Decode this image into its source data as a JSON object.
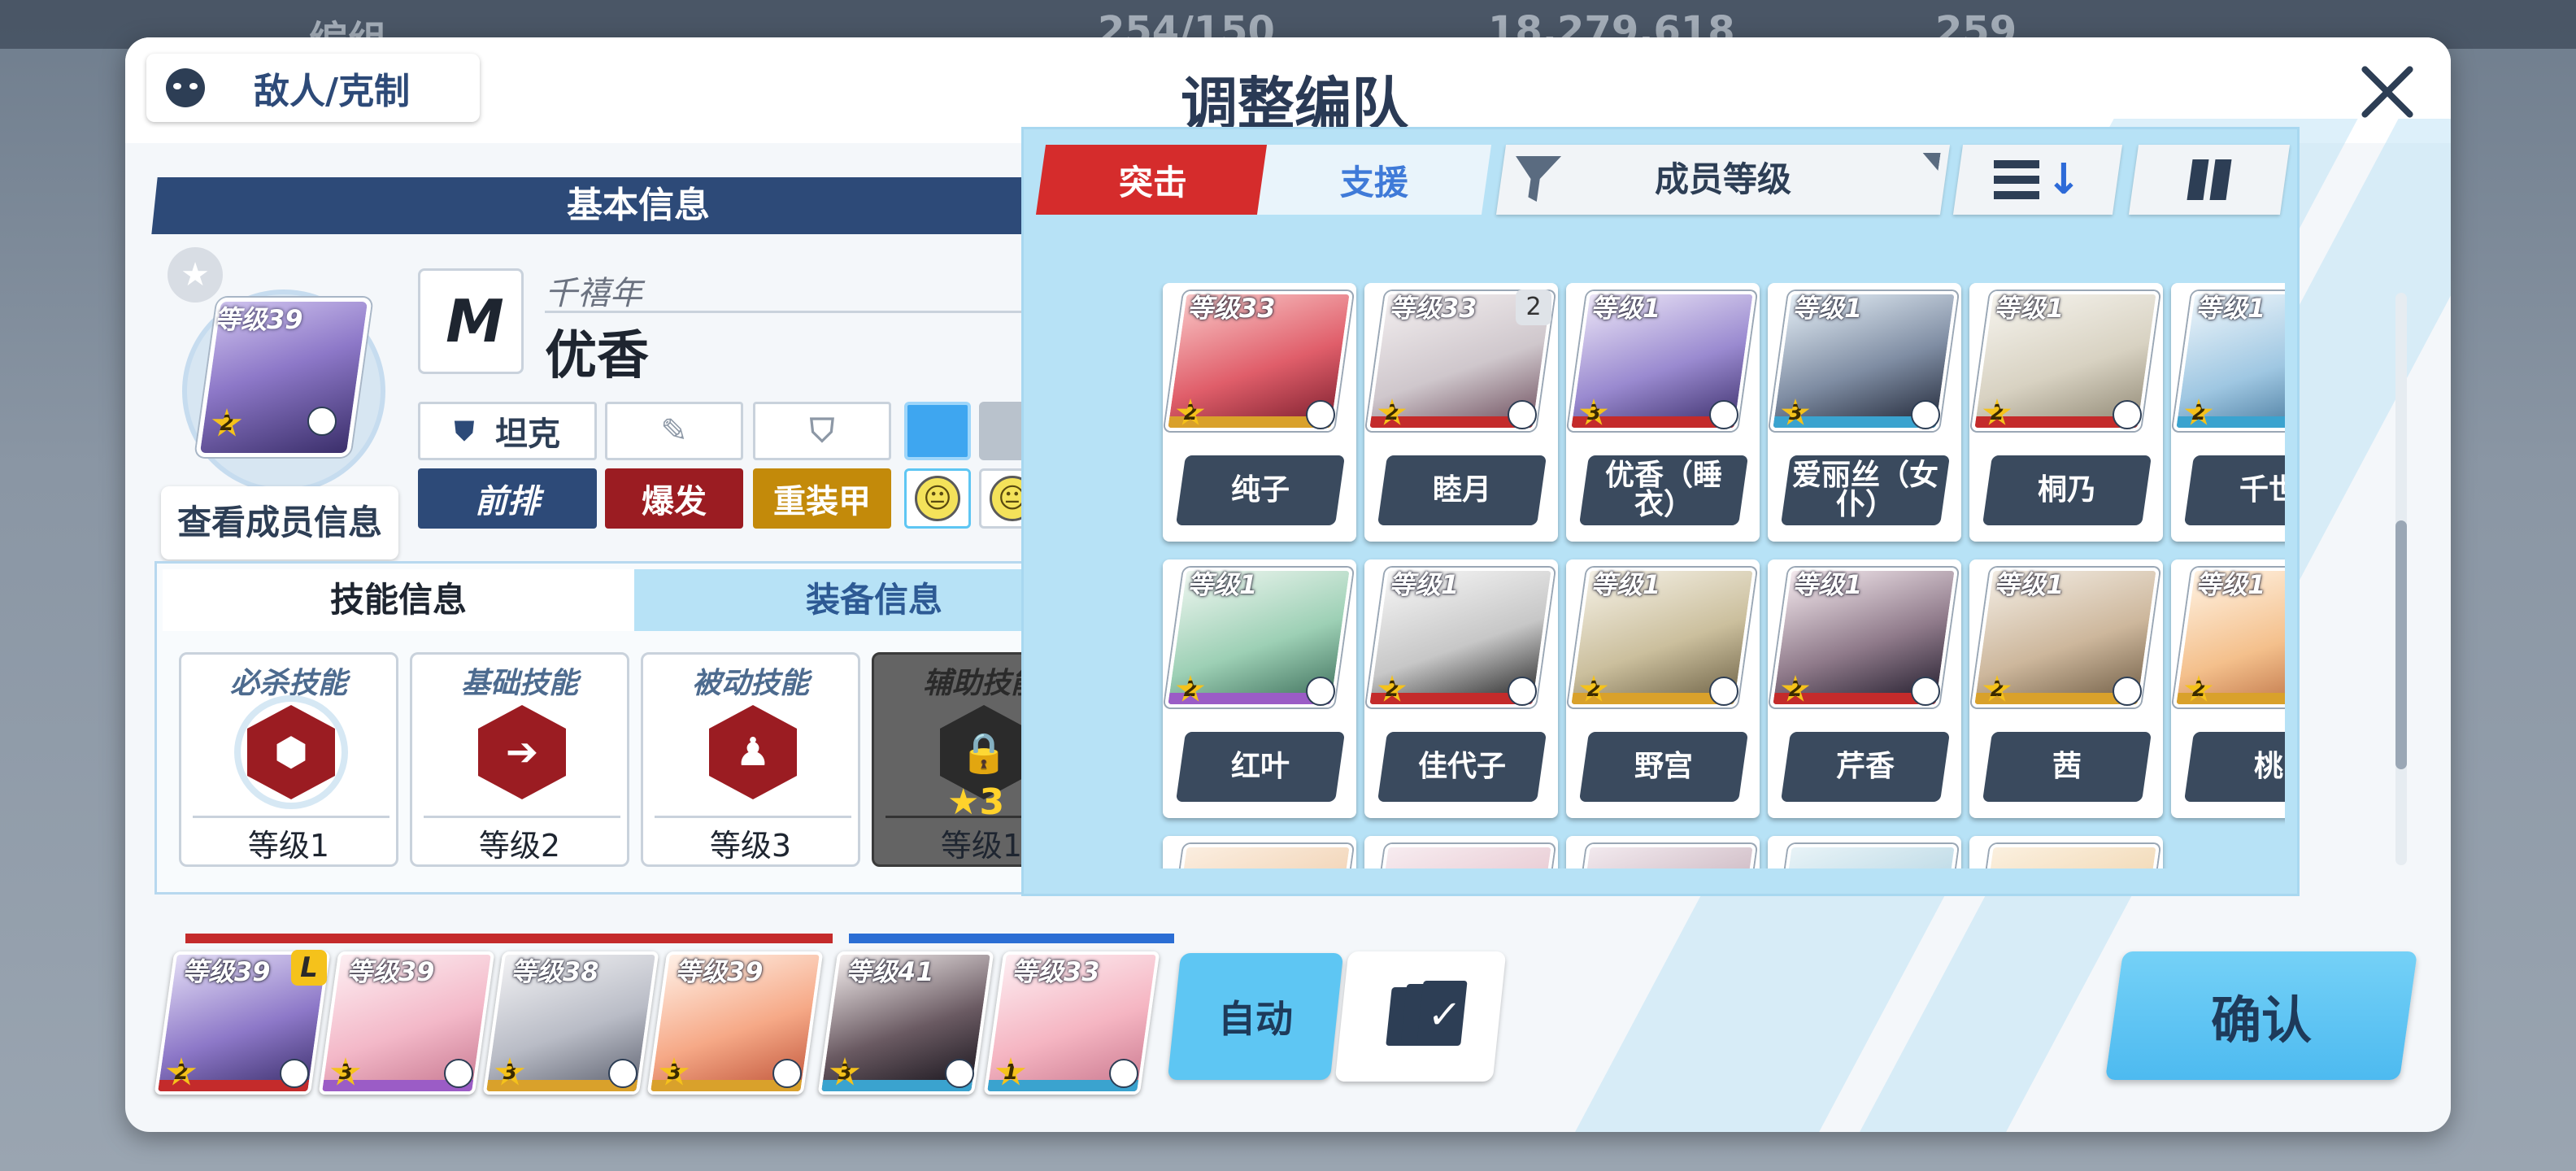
{
  "background": {
    "topbar_items": [
      "编组",
      "254/150",
      "18,279,618",
      "259"
    ]
  },
  "header": {
    "enemy_button": "敌人/克制",
    "title": "调整编队",
    "close_icon": "close-icon"
  },
  "info": {
    "section_title": "基本信息",
    "level": "等级39",
    "star": "2",
    "view_member_button": "查看成员信息",
    "school": "千禧年",
    "name": "优香",
    "role": "坦克",
    "position": "前排",
    "attack_type": "爆发",
    "defense_type": "重装甲",
    "terrain_faces": [
      "😐",
      "😐",
      "🙂"
    ],
    "colors": {
      "attack": "#9b1c22",
      "defense": "#c38a0a",
      "position": "#2d4a78"
    }
  },
  "skills": {
    "tab_active": "技能信息",
    "tab_inactive": "装备信息",
    "cards": [
      {
        "name": "必杀技能",
        "level": "等级1"
      },
      {
        "name": "基础技能",
        "level": "等级2"
      },
      {
        "name": "被动技能",
        "level": "等级3"
      },
      {
        "name": "辅助技能",
        "level": "等级1",
        "star": "3"
      }
    ]
  },
  "roster": {
    "tab_strike": "突击",
    "tab_special": "支援",
    "sort_label": "成员等级",
    "row1": [
      {
        "level": "等级33",
        "star": "2",
        "name": "纯子"
      },
      {
        "level": "等级33",
        "star": "2",
        "name": "睦月",
        "count": "2"
      },
      {
        "level": "等级1",
        "star": "3",
        "name": "优香（睡衣）"
      },
      {
        "level": "等级1",
        "star": "3",
        "name": "爱丽丝（女仆）"
      },
      {
        "level": "等级1",
        "star": "2",
        "name": "桐乃"
      },
      {
        "level": "等级1",
        "star": "2",
        "name": "千世"
      }
    ],
    "row2": [
      {
        "level": "等级1",
        "star": "2",
        "name": "红叶"
      },
      {
        "level": "等级1",
        "star": "2",
        "name": "佳代子"
      },
      {
        "level": "等级1",
        "star": "2",
        "name": "野宫"
      },
      {
        "level": "等级1",
        "star": "2",
        "name": "芹香"
      },
      {
        "level": "等级1",
        "star": "2",
        "name": "茜"
      },
      {
        "level": "等级1",
        "star": "2",
        "name": "桃"
      }
    ]
  },
  "team": {
    "members": [
      {
        "level": "等级39",
        "star": "2"
      },
      {
        "level": "等级39",
        "star": "3"
      },
      {
        "level": "等级38",
        "star": "3"
      },
      {
        "level": "等级39",
        "star": "3"
      },
      {
        "level": "等级41",
        "star": "3"
      },
      {
        "level": "等级33",
        "star": "1"
      }
    ],
    "leader": "L",
    "auto_button": "自动",
    "confirm_button": "确认"
  }
}
